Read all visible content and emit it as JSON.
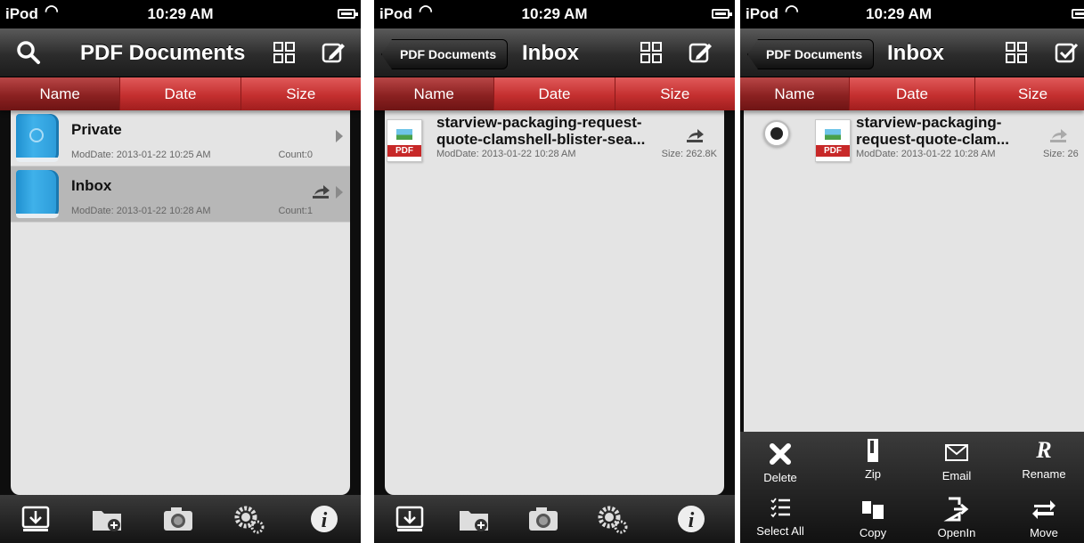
{
  "status": {
    "carrier": "iPod",
    "time": "10:29 AM"
  },
  "screen1": {
    "title": "PDF Documents",
    "sort_tabs": [
      "Name",
      "Date",
      "Size"
    ],
    "folders": [
      {
        "name": "Private",
        "moddate": "ModDate: 2013-01-22 10:25 AM",
        "count": "Count:0"
      },
      {
        "name": "Inbox",
        "moddate": "ModDate: 2013-01-22 10:28 AM",
        "count": "Count:1"
      }
    ],
    "toolbar": [
      "import-icon",
      "new-folder-icon",
      "camera-icon",
      "settings-icon",
      "info-icon"
    ]
  },
  "screen2": {
    "back_label": "PDF Documents",
    "title": "Inbox",
    "sort_tabs": [
      "Name",
      "Date",
      "Size"
    ],
    "file": {
      "line1": "starview-packaging-request-",
      "line2": "quote-clamshell-blister-sea...",
      "moddate": "ModDate: 2013-01-22 10:28 AM",
      "size": "Size: 262.8K",
      "icon_label": "PDF"
    }
  },
  "screen3": {
    "back_label": "PDF Documents",
    "title": "Inbox",
    "sort_tabs": [
      "Name",
      "Date",
      "Size"
    ],
    "file": {
      "line1": "starview-packaging-",
      "line2": "request-quote-clam...",
      "moddate": "ModDate: 2013-01-22 10:28 AM",
      "size": "Size: 26",
      "icon_label": "PDF"
    },
    "actions_row1": [
      "Delete",
      "Zip",
      "Email",
      "Rename"
    ],
    "actions_row2": [
      "Select All",
      "Copy",
      "OpenIn",
      "Move"
    ],
    "rename_glyph": "R"
  },
  "colors": {
    "accent_red": "#c42f2f",
    "folder_blue": "#3fb1ea",
    "list_bg": "#e4e4e4"
  }
}
